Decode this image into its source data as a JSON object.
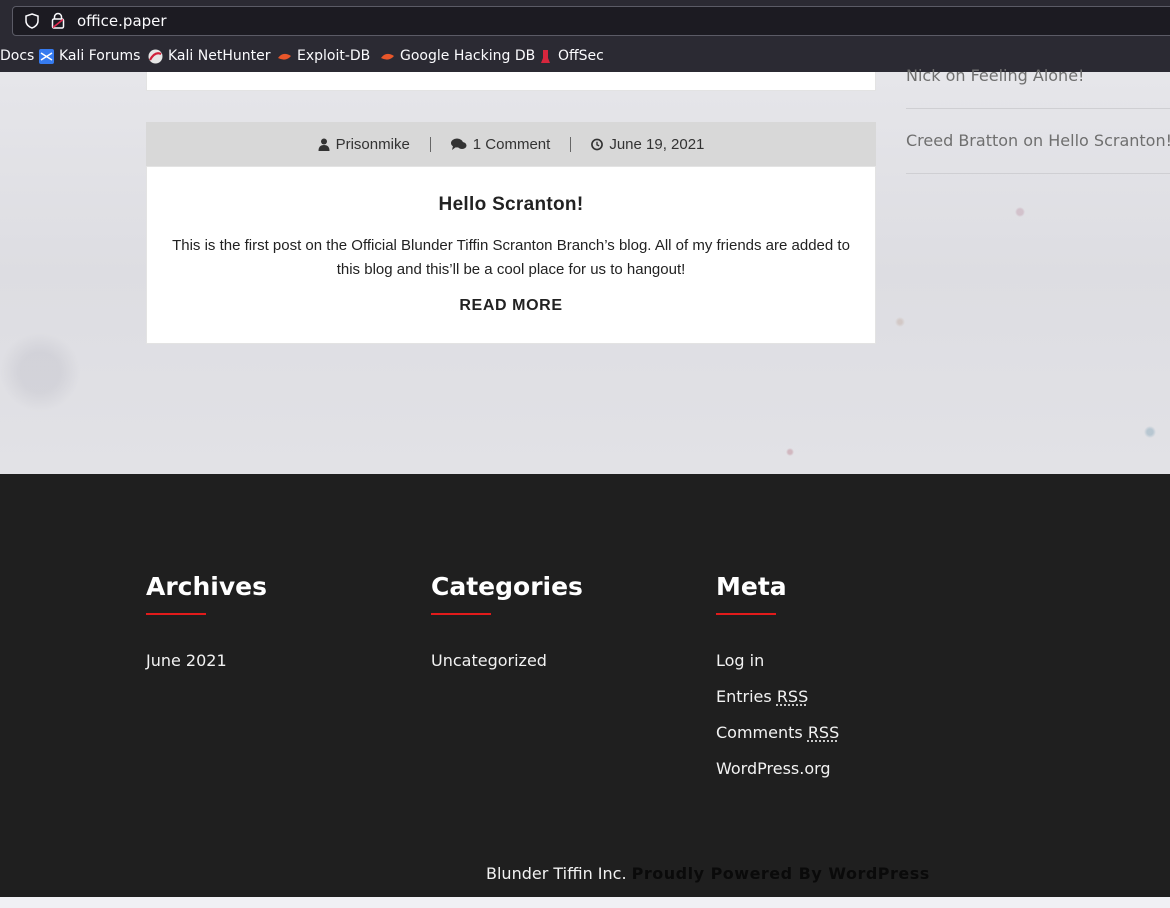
{
  "browser": {
    "url": "office.paper",
    "bookmarks": [
      {
        "label": "Docs",
        "icon": "docs-icon"
      },
      {
        "label": "Kali Forums",
        "icon": "kali-forums-icon"
      },
      {
        "label": "Kali NetHunter",
        "icon": "kali-nethunter-icon"
      },
      {
        "label": "Exploit-DB",
        "icon": "exploit-db-icon"
      },
      {
        "label": "Google Hacking DB",
        "icon": "google-hacking-db-icon"
      },
      {
        "label": "OffSec",
        "icon": "offsec-icon"
      }
    ]
  },
  "post": {
    "author": "Prisonmike",
    "comments": "1 Comment",
    "date": "June 19, 2021",
    "title": "Hello Scranton!",
    "excerpt": "This is the first post on the Official Blunder Tiffin Scranton Branch’s blog. All of my friends are added to this blog and this’ll be a cool place for us to hangout!",
    "read_more": "READ MORE"
  },
  "sidebar": {
    "recent_comments": [
      "Nick on Feeling Alone!",
      "Creed Bratton on Hello Scranton!"
    ]
  },
  "footer": {
    "archives": {
      "title": "Archives",
      "items": [
        "June 2021"
      ]
    },
    "categories": {
      "title": "Categories",
      "items": [
        "Uncategorized"
      ]
    },
    "meta": {
      "title": "Meta",
      "log_in": "Log in",
      "entries_prefix": "Entries ",
      "comments_prefix": "Comments ",
      "rss": "RSS",
      "wordpress": "WordPress.org"
    },
    "credits_text": "Blunder Tiffin Inc.",
    "credits_link": "Proudly Powered By WordPress"
  },
  "colors": {
    "accent": "#e21b1b",
    "footer_bg": "#1f1f1f",
    "meta_bar": "#d8d8d8"
  }
}
